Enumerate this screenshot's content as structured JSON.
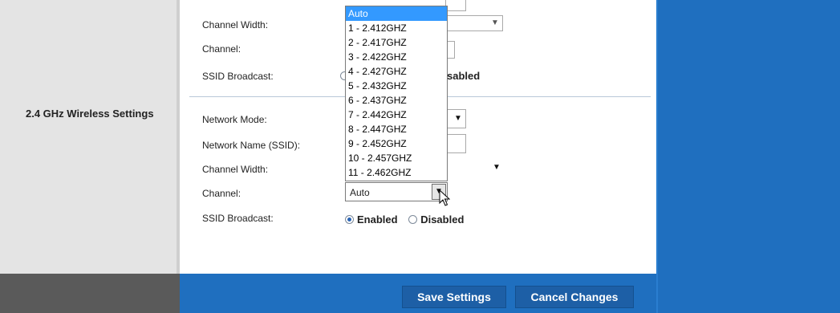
{
  "sidebar": {
    "section_title": "2.4 GHz Wireless Settings"
  },
  "upper_block": {
    "channel_width_label": "Channel Width:",
    "channel_label": "Channel:",
    "ssid_broadcast_label": "SSID Broadcast:",
    "ssid_broadcast_partial_option": "sabled"
  },
  "lower_block": {
    "network_mode_label": "Network Mode:",
    "network_name_label": "Network Name (SSID):",
    "channel_width_label": "Channel Width:",
    "channel_label": "Channel:",
    "channel_value": "Auto",
    "ssid_broadcast_label": "SSID Broadcast:",
    "ssid_enabled": "Enabled",
    "ssid_disabled": "Disabled",
    "ssid_selected": "Enabled"
  },
  "channel_dropdown": {
    "options": [
      "Auto",
      "1 - 2.412GHZ",
      "2 - 2.417GHZ",
      "3 - 2.422GHZ",
      "4 - 2.427GHZ",
      "5 - 2.432GHZ",
      "6 - 2.437GHZ",
      "7 - 2.442GHZ",
      "8 - 2.447GHZ",
      "9 - 2.452GHZ",
      "10 - 2.457GHZ",
      "11 - 2.462GHZ"
    ],
    "highlighted": "Auto"
  },
  "footer": {
    "save_label": "Save Settings",
    "cancel_label": "Cancel Changes"
  },
  "colors": {
    "brand_blue": "#1f6fbf",
    "dropdown_highlight": "#3399ff",
    "sidebar_gray": "#e4e4e4",
    "footer_dark": "#5a5a5a"
  },
  "icons": {
    "dropdown_arrow": "chevron-down-icon",
    "mouse_pointer": "cursor-icon"
  }
}
